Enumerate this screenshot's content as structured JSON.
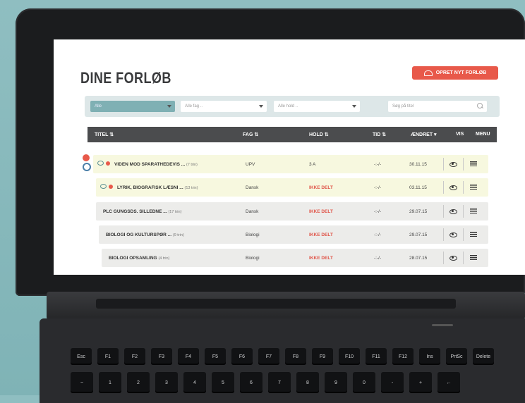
{
  "app": {
    "title": "DINE FORLØB",
    "new_button_label": "OPRET NYT FORLØB"
  },
  "filters": {
    "first_value": "Alle",
    "subject_placeholder": "Alle fag ..",
    "class_placeholder": "Alle hold ..",
    "search_placeholder": "Søg på titel"
  },
  "table": {
    "headers": {
      "title": "TITEL ⇅",
      "subject": "FAG ⇅",
      "class": "HOLD ⇅",
      "time": "TID ⇅",
      "changed": "ÆNDRET ▾",
      "view": "VIS",
      "menu": "MENU"
    },
    "rows": [
      {
        "title": "VIDEN MOD SPARATHEDEVIS ...",
        "sub": "(7 trin)",
        "subject": "UPV",
        "class": "3 A",
        "time": "-:-/-",
        "changed": "30.11.15",
        "highlight": true,
        "shared": false
      },
      {
        "title": "LYRIK, BIOGRAFISK LÆSNI ...",
        "sub": "(13 trin)",
        "subject": "Dansk",
        "class": "IKKE DELT",
        "time": "-:-/-",
        "changed": "03.11.15",
        "highlight": true,
        "shared": true
      },
      {
        "title": "PLC GUNGSDS. SILLEDNE ...",
        "sub": "(17 trin)",
        "subject": "Dansk",
        "class": "IKKE DELT",
        "time": "-:-/-",
        "changed": "29.07.15",
        "highlight": false,
        "shared": true
      },
      {
        "title": "BIOLOGI OG KULTURSPØR ...",
        "sub": "(9 trin)",
        "subject": "Biologi",
        "class": "IKKE DELT",
        "time": "-:-/-",
        "changed": "29.07.15",
        "highlight": false,
        "shared": true
      },
      {
        "title": "BIOLOGI OPSAMLING",
        "sub": "(4 trin)",
        "subject": "Biologi",
        "class": "IKKE DELT",
        "time": "-:-/-",
        "changed": "28.07.15",
        "highlight": false,
        "shared": true
      }
    ]
  },
  "keyboard": {
    "row1": [
      "Esc",
      "F1",
      "F2",
      "F3",
      "F4",
      "F5",
      "F6",
      "F7",
      "F8",
      "F9",
      "F10",
      "F11",
      "F12",
      "Ins",
      "PrtSc",
      "Delete"
    ],
    "row2": [
      "~",
      "1",
      "2",
      "3",
      "4",
      "5",
      "6",
      "7",
      "8",
      "9",
      "0",
      "-",
      "+",
      "←"
    ]
  },
  "colors": {
    "accent": "#e8594a",
    "header_bg": "#4b4c4e",
    "highlight_row": "#f7f8df",
    "filter_active": "#7fb0b4"
  }
}
